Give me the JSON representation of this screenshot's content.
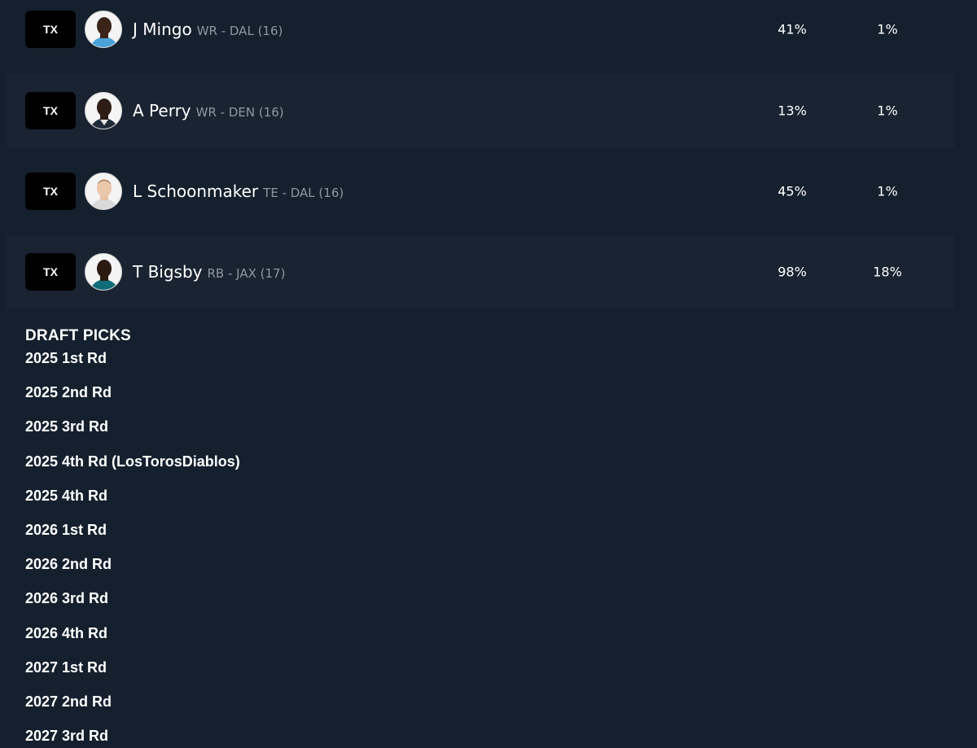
{
  "players": [
    {
      "action_label": "TX",
      "name": "J Mingo",
      "meta": "WR - DAL (16)",
      "stat1": "41%",
      "stat2": "1%",
      "avatar_icon": "player-headshot-icon",
      "jersey_color": "#4aa3d8"
    },
    {
      "action_label": "TX",
      "name": "A Perry",
      "meta": "WR - DEN (16)",
      "stat1": "13%",
      "stat2": "1%",
      "avatar_icon": "player-headshot-icon",
      "jersey_color": "#1f2a38"
    },
    {
      "action_label": "TX",
      "name": "L Schoonmaker",
      "meta": "TE - DAL (16)",
      "stat1": "45%",
      "stat2": "1%",
      "avatar_icon": "player-headshot-icon",
      "jersey_color": "#d9d9d9"
    },
    {
      "action_label": "TX",
      "name": "T Bigsby",
      "meta": "RB - JAX (17)",
      "stat1": "98%",
      "stat2": "18%",
      "avatar_icon": "player-headshot-icon",
      "jersey_color": "#0f6b7a"
    }
  ],
  "draft_picks": {
    "title": "DRAFT PICKS",
    "items": [
      "2025 1st Rd",
      "2025 2nd Rd",
      "2025 3rd Rd",
      "2025 4th Rd (LosTorosDiablos)",
      "2025 4th Rd",
      "2026 1st Rd",
      "2026 2nd Rd",
      "2026 3rd Rd",
      "2026 4th Rd",
      "2027 1st Rd",
      "2027 2nd Rd",
      "2027 3rd Rd"
    ]
  },
  "colors": {
    "background": "#15202e",
    "row_alt": "#1a2331",
    "meta_text": "#8e96a3"
  }
}
